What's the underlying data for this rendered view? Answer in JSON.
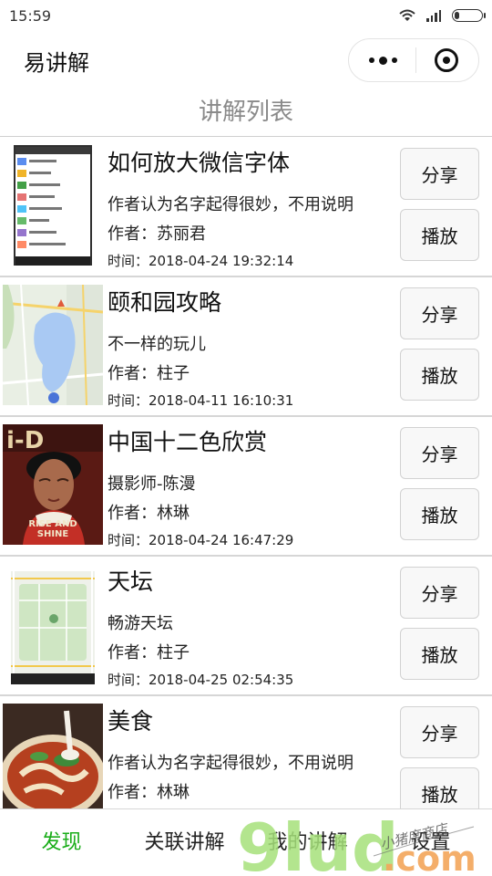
{
  "status_bar": {
    "time": "15:59"
  },
  "header": {
    "title": "易讲解"
  },
  "list_heading": "讲解列表",
  "items": [
    {
      "title": "如何放大微信字体",
      "desc": "作者认为名字起得很妙，不用说明",
      "author": "作者：苏丽君",
      "time": "时间：2018-04-24 19:32:14",
      "share_label": "分享",
      "play_label": "播放",
      "thumb": "phone-screenshot"
    },
    {
      "title": "颐和园攻略",
      "desc": "不一样的玩儿",
      "author": "作者：柱子",
      "time": "时间：2018-04-11 16:10:31",
      "share_label": "分享",
      "play_label": "播放",
      "thumb": "map-lake"
    },
    {
      "title": "中国十二色欣赏",
      "desc": "摄影师-陈漫",
      "author": "作者：林琳",
      "time": "时间：2018-04-24 16:47:29",
      "share_label": "分享",
      "play_label": "播放",
      "thumb": "magazine-cover"
    },
    {
      "title": "天坛",
      "desc": "畅游天坛",
      "author": "作者：柱子",
      "time": "时间：2018-04-25 02:54:35",
      "share_label": "分享",
      "play_label": "播放",
      "thumb": "map-park"
    },
    {
      "title": "美食",
      "desc": "作者认为名字起得很妙，不用说明",
      "author": "作者：林琳",
      "time": "",
      "share_label": "分享",
      "play_label": "播放",
      "thumb": "noodle-bowl"
    }
  ],
  "thumb_text": {
    "cover_line1": "RISE AND",
    "cover_line2": "SHINE"
  },
  "tabs": [
    {
      "label": "发现",
      "active": true
    },
    {
      "label": "关联讲解",
      "active": false
    },
    {
      "label": "我的讲解",
      "active": false
    },
    {
      "label": "设置",
      "active": false
    }
  ],
  "watermark": {
    "logo_text": "9lud",
    "suffix": ".com",
    "script_text": "小猪席商店"
  },
  "colors": {
    "accent": "#1aad19",
    "heading_gray": "#8a8a8a",
    "button_bg": "#f8f8f8"
  }
}
